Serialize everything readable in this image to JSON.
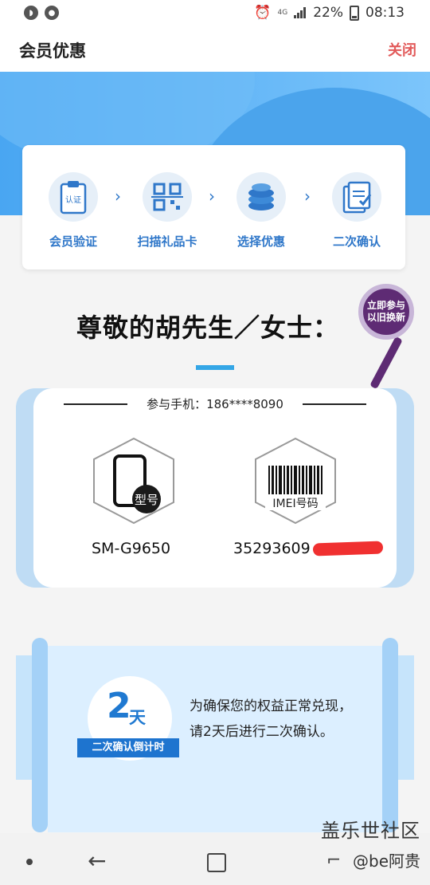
{
  "status_bar": {
    "battery": "22%",
    "time": "08:13",
    "network": "4G"
  },
  "header": {
    "title": "会员优惠",
    "close_label": "关闭"
  },
  "steps": [
    {
      "label": "会员验证",
      "icon": "clipboard-certify-icon",
      "icon_text": "认证"
    },
    {
      "label": "扫描礼品卡",
      "icon": "qr-scan-icon"
    },
    {
      "label": "选择优惠",
      "icon": "coins-icon"
    },
    {
      "label": "二次确认",
      "icon": "document-check-icon"
    }
  ],
  "greeting": "尊敬的胡先生／女士：",
  "badge": {
    "line1": "立即参与",
    "line2": "以旧换新"
  },
  "phone": {
    "label": "参与手机：186****8090",
    "model_badge": "型号",
    "model_value": "SM-G9650",
    "imei_label": "IMEI号码",
    "imei_value": "35293609"
  },
  "confirm": {
    "days_num": "2",
    "days_unit": "天",
    "ribbon_label": "二次确认倒计时",
    "line1": "为确保您的权益正常兑现，",
    "line2": "请2天后进行二次确认。"
  },
  "watermark": {
    "line1": "盖乐世社区",
    "line2": "@be阿贵"
  },
  "colors": {
    "accent_blue": "#2f77c9",
    "close_red": "#e25a5a",
    "badge_purple": "#5e2b74"
  }
}
